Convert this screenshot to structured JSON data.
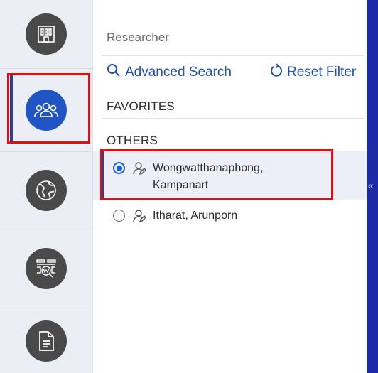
{
  "nav": {
    "items": [
      {
        "icon": "building-icon",
        "active": false
      },
      {
        "icon": "people-group-icon",
        "active": true
      },
      {
        "icon": "globe-icon",
        "active": false
      },
      {
        "icon": "web-search-icon",
        "active": false
      },
      {
        "icon": "document-icon",
        "active": false
      }
    ]
  },
  "panel": {
    "title": "Researcher",
    "advanced_search": "Advanced Search",
    "reset_filter": "Reset Filter",
    "favorites_label": "FAVORITES",
    "others_label": "OTHERS",
    "others": [
      {
        "name_line1": "Wongwatthanaphong,",
        "name_line2": "Kampanart",
        "selected": true
      },
      {
        "name_line1": "Itharat, Arunporn",
        "name_line2": "",
        "selected": false
      }
    ]
  },
  "colors": {
    "accent": "#1e4fb4",
    "active_nav": "#2155c4",
    "highlight": "#e01010",
    "side_strip": "#1d2aa6"
  }
}
